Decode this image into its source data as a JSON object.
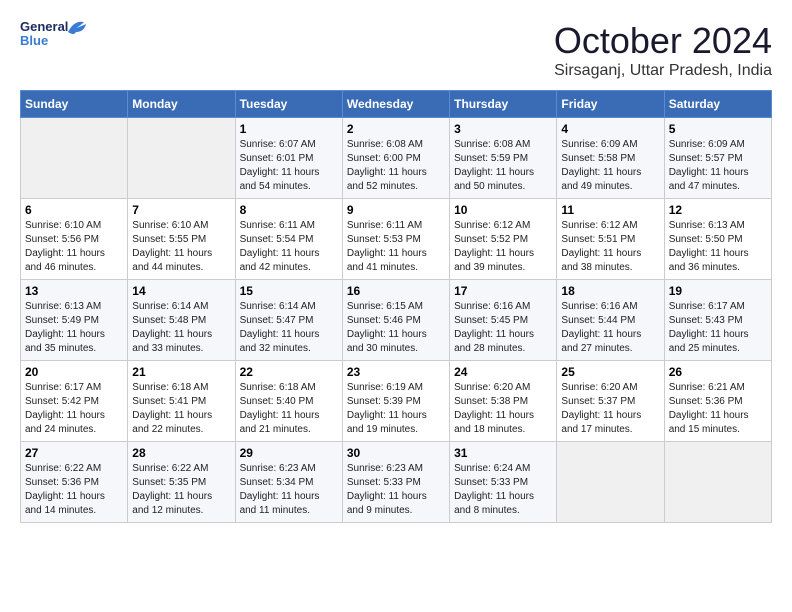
{
  "header": {
    "logo_general": "General",
    "logo_blue": "Blue",
    "month_title": "October 2024",
    "location": "Sirsaganj, Uttar Pradesh, India"
  },
  "days_of_week": [
    "Sunday",
    "Monday",
    "Tuesday",
    "Wednesday",
    "Thursday",
    "Friday",
    "Saturday"
  ],
  "weeks": [
    {
      "days": [
        {
          "num": "",
          "empty": true
        },
        {
          "num": "",
          "empty": true
        },
        {
          "num": "1",
          "sunrise": "Sunrise: 6:07 AM",
          "sunset": "Sunset: 6:01 PM",
          "daylight": "Daylight: 11 hours and 54 minutes."
        },
        {
          "num": "2",
          "sunrise": "Sunrise: 6:08 AM",
          "sunset": "Sunset: 6:00 PM",
          "daylight": "Daylight: 11 hours and 52 minutes."
        },
        {
          "num": "3",
          "sunrise": "Sunrise: 6:08 AM",
          "sunset": "Sunset: 5:59 PM",
          "daylight": "Daylight: 11 hours and 50 minutes."
        },
        {
          "num": "4",
          "sunrise": "Sunrise: 6:09 AM",
          "sunset": "Sunset: 5:58 PM",
          "daylight": "Daylight: 11 hours and 49 minutes."
        },
        {
          "num": "5",
          "sunrise": "Sunrise: 6:09 AM",
          "sunset": "Sunset: 5:57 PM",
          "daylight": "Daylight: 11 hours and 47 minutes."
        }
      ]
    },
    {
      "days": [
        {
          "num": "6",
          "sunrise": "Sunrise: 6:10 AM",
          "sunset": "Sunset: 5:56 PM",
          "daylight": "Daylight: 11 hours and 46 minutes."
        },
        {
          "num": "7",
          "sunrise": "Sunrise: 6:10 AM",
          "sunset": "Sunset: 5:55 PM",
          "daylight": "Daylight: 11 hours and 44 minutes."
        },
        {
          "num": "8",
          "sunrise": "Sunrise: 6:11 AM",
          "sunset": "Sunset: 5:54 PM",
          "daylight": "Daylight: 11 hours and 42 minutes."
        },
        {
          "num": "9",
          "sunrise": "Sunrise: 6:11 AM",
          "sunset": "Sunset: 5:53 PM",
          "daylight": "Daylight: 11 hours and 41 minutes."
        },
        {
          "num": "10",
          "sunrise": "Sunrise: 6:12 AM",
          "sunset": "Sunset: 5:52 PM",
          "daylight": "Daylight: 11 hours and 39 minutes."
        },
        {
          "num": "11",
          "sunrise": "Sunrise: 6:12 AM",
          "sunset": "Sunset: 5:51 PM",
          "daylight": "Daylight: 11 hours and 38 minutes."
        },
        {
          "num": "12",
          "sunrise": "Sunrise: 6:13 AM",
          "sunset": "Sunset: 5:50 PM",
          "daylight": "Daylight: 11 hours and 36 minutes."
        }
      ]
    },
    {
      "days": [
        {
          "num": "13",
          "sunrise": "Sunrise: 6:13 AM",
          "sunset": "Sunset: 5:49 PM",
          "daylight": "Daylight: 11 hours and 35 minutes."
        },
        {
          "num": "14",
          "sunrise": "Sunrise: 6:14 AM",
          "sunset": "Sunset: 5:48 PM",
          "daylight": "Daylight: 11 hours and 33 minutes."
        },
        {
          "num": "15",
          "sunrise": "Sunrise: 6:14 AM",
          "sunset": "Sunset: 5:47 PM",
          "daylight": "Daylight: 11 hours and 32 minutes."
        },
        {
          "num": "16",
          "sunrise": "Sunrise: 6:15 AM",
          "sunset": "Sunset: 5:46 PM",
          "daylight": "Daylight: 11 hours and 30 minutes."
        },
        {
          "num": "17",
          "sunrise": "Sunrise: 6:16 AM",
          "sunset": "Sunset: 5:45 PM",
          "daylight": "Daylight: 11 hours and 28 minutes."
        },
        {
          "num": "18",
          "sunrise": "Sunrise: 6:16 AM",
          "sunset": "Sunset: 5:44 PM",
          "daylight": "Daylight: 11 hours and 27 minutes."
        },
        {
          "num": "19",
          "sunrise": "Sunrise: 6:17 AM",
          "sunset": "Sunset: 5:43 PM",
          "daylight": "Daylight: 11 hours and 25 minutes."
        }
      ]
    },
    {
      "days": [
        {
          "num": "20",
          "sunrise": "Sunrise: 6:17 AM",
          "sunset": "Sunset: 5:42 PM",
          "daylight": "Daylight: 11 hours and 24 minutes."
        },
        {
          "num": "21",
          "sunrise": "Sunrise: 6:18 AM",
          "sunset": "Sunset: 5:41 PM",
          "daylight": "Daylight: 11 hours and 22 minutes."
        },
        {
          "num": "22",
          "sunrise": "Sunrise: 6:18 AM",
          "sunset": "Sunset: 5:40 PM",
          "daylight": "Daylight: 11 hours and 21 minutes."
        },
        {
          "num": "23",
          "sunrise": "Sunrise: 6:19 AM",
          "sunset": "Sunset: 5:39 PM",
          "daylight": "Daylight: 11 hours and 19 minutes."
        },
        {
          "num": "24",
          "sunrise": "Sunrise: 6:20 AM",
          "sunset": "Sunset: 5:38 PM",
          "daylight": "Daylight: 11 hours and 18 minutes."
        },
        {
          "num": "25",
          "sunrise": "Sunrise: 6:20 AM",
          "sunset": "Sunset: 5:37 PM",
          "daylight": "Daylight: 11 hours and 17 minutes."
        },
        {
          "num": "26",
          "sunrise": "Sunrise: 6:21 AM",
          "sunset": "Sunset: 5:36 PM",
          "daylight": "Daylight: 11 hours and 15 minutes."
        }
      ]
    },
    {
      "days": [
        {
          "num": "27",
          "sunrise": "Sunrise: 6:22 AM",
          "sunset": "Sunset: 5:36 PM",
          "daylight": "Daylight: 11 hours and 14 minutes."
        },
        {
          "num": "28",
          "sunrise": "Sunrise: 6:22 AM",
          "sunset": "Sunset: 5:35 PM",
          "daylight": "Daylight: 11 hours and 12 minutes."
        },
        {
          "num": "29",
          "sunrise": "Sunrise: 6:23 AM",
          "sunset": "Sunset: 5:34 PM",
          "daylight": "Daylight: 11 hours and 11 minutes."
        },
        {
          "num": "30",
          "sunrise": "Sunrise: 6:23 AM",
          "sunset": "Sunset: 5:33 PM",
          "daylight": "Daylight: 11 hours and 9 minutes."
        },
        {
          "num": "31",
          "sunrise": "Sunrise: 6:24 AM",
          "sunset": "Sunset: 5:33 PM",
          "daylight": "Daylight: 11 hours and 8 minutes."
        },
        {
          "num": "",
          "empty": true
        },
        {
          "num": "",
          "empty": true
        }
      ]
    }
  ]
}
